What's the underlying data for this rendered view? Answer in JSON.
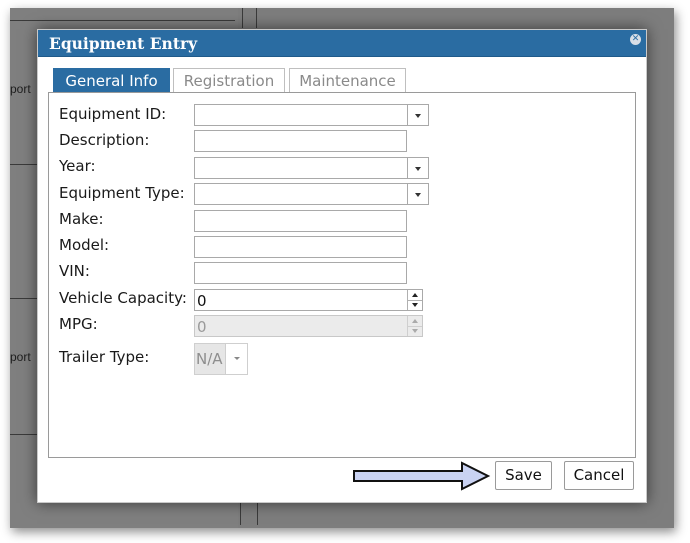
{
  "background": {
    "left_panel_text_1": "port",
    "left_panel_text_2": "port"
  },
  "dialog": {
    "title": "Equipment Entry",
    "close_icon": "close-icon",
    "tabs": [
      {
        "label": "General Info",
        "active": true
      },
      {
        "label": "Registration",
        "active": false
      },
      {
        "label": "Maintenance",
        "active": false
      }
    ],
    "fields": {
      "equipment_id": {
        "label": "Equipment ID:",
        "value": ""
      },
      "description": {
        "label": "Description:",
        "value": ""
      },
      "year": {
        "label": "Year:",
        "value": ""
      },
      "equipment_type": {
        "label": "Equipment Type:",
        "value": ""
      },
      "make": {
        "label": "Make:",
        "value": ""
      },
      "model": {
        "label": "Model:",
        "value": ""
      },
      "vin": {
        "label": "VIN:",
        "value": ""
      },
      "vehicle_capacity": {
        "label": "Vehicle Capacity:",
        "value": "0"
      },
      "mpg": {
        "label": "MPG:",
        "value": "0"
      },
      "trailer_type": {
        "label": "Trailer Type:",
        "value": "N/A"
      }
    },
    "buttons": {
      "save": "Save",
      "cancel": "Cancel"
    },
    "annotation_arrow_color": "#c9d2f2"
  },
  "colors": {
    "title_bar": "#2a6ca2",
    "active_tab": "#2a6ca2",
    "overlay": "#7d7d7d"
  }
}
